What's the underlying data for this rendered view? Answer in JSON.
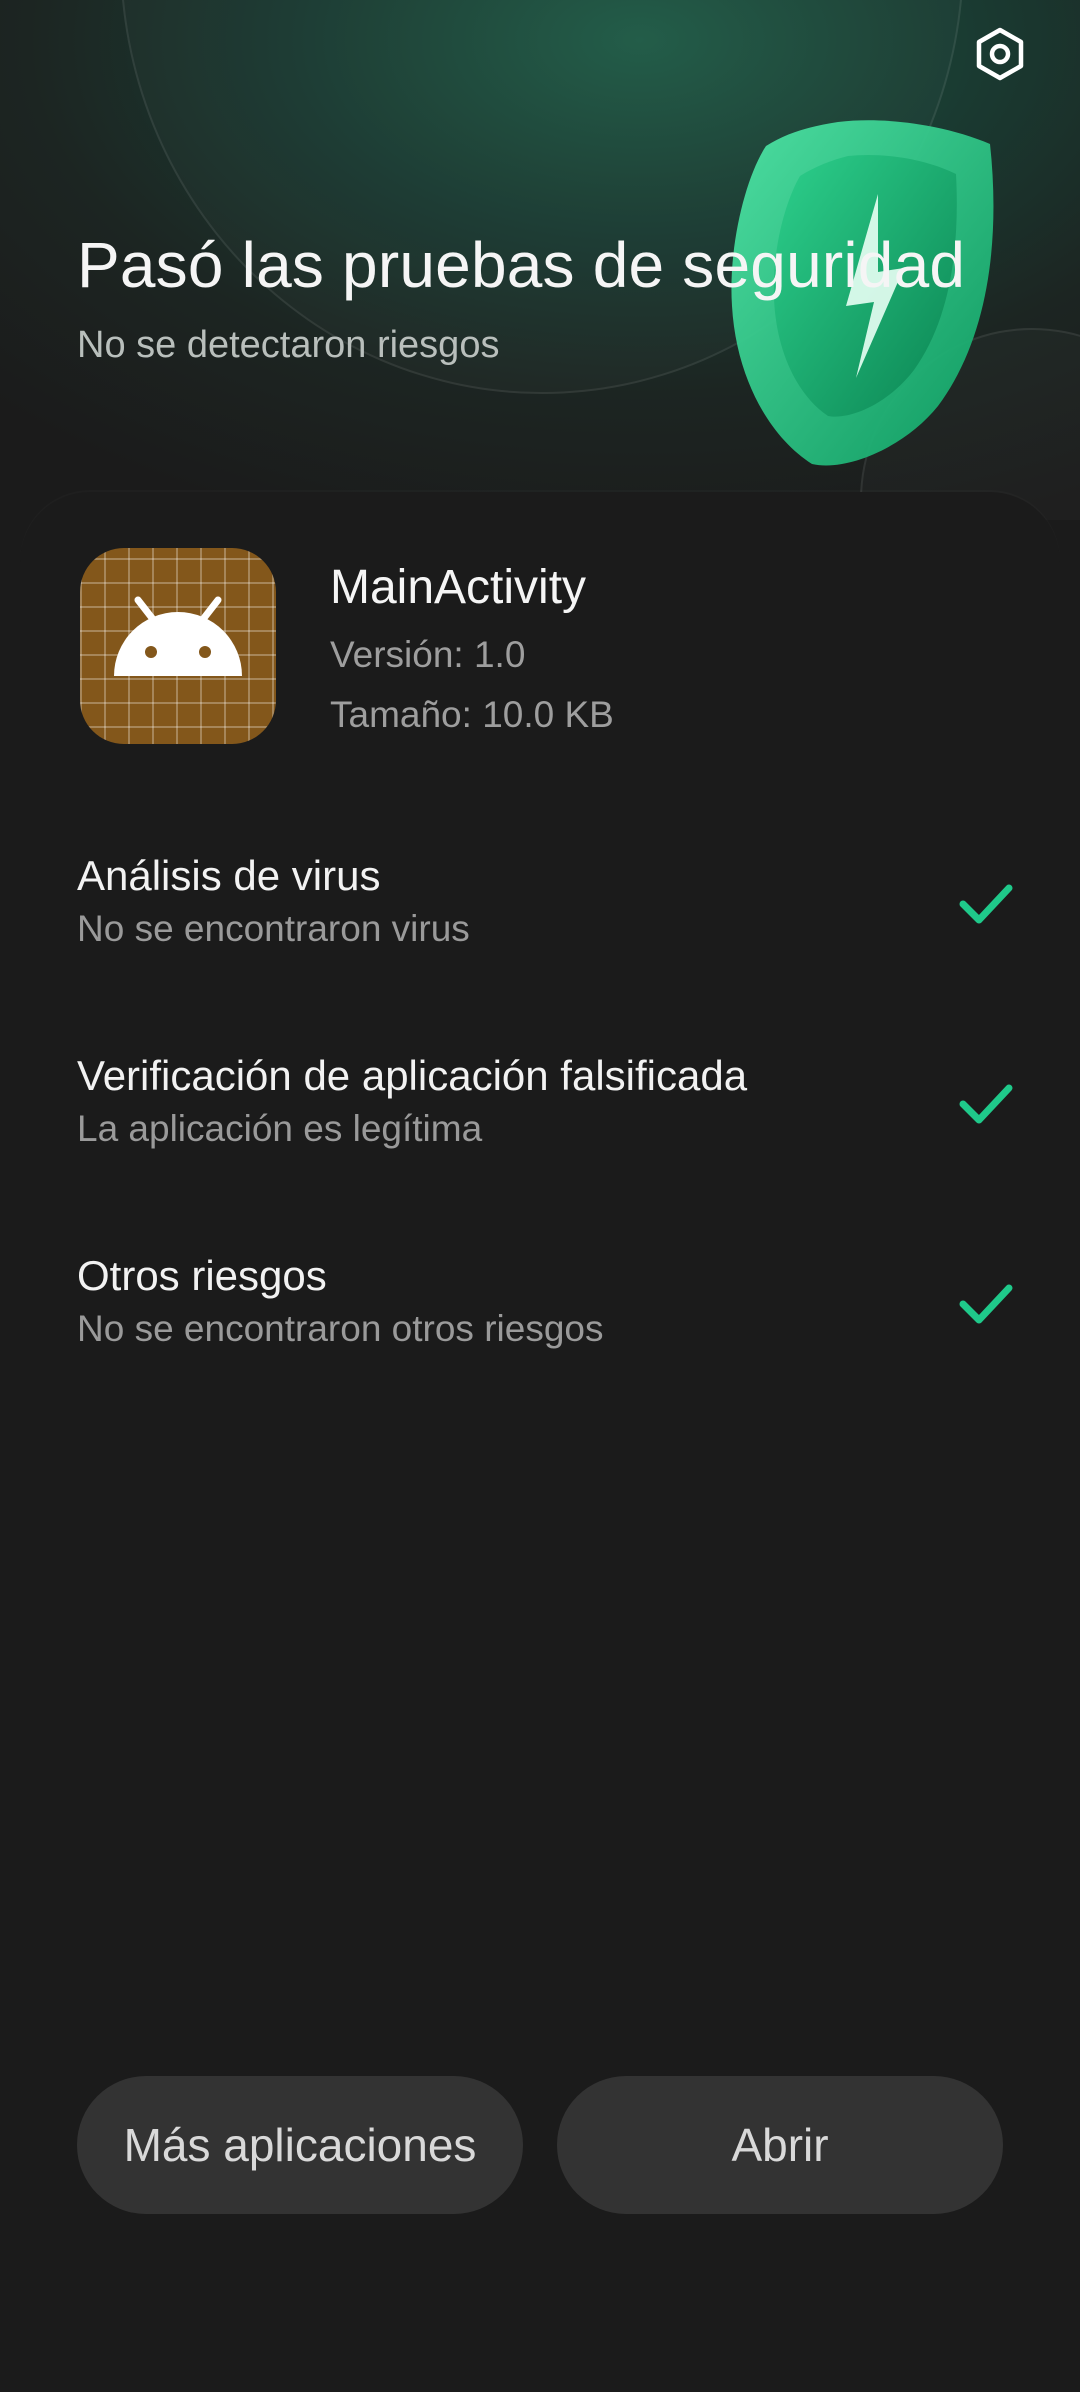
{
  "header": {
    "title": "Pasó las pruebas de seguridad",
    "subtitle": "No se detectaron riesgos",
    "settings_icon": "settings-hexagon-icon",
    "illustration": "shield-check-icon"
  },
  "app": {
    "name": "MainActivity",
    "version": "Versión: 1.0",
    "size": "Tamaño: 10.0 KB",
    "icon": "android-robot-icon"
  },
  "checks": [
    {
      "title": "Análisis de virus",
      "description": "No se encontraron virus",
      "status_icon": "checkmark-icon"
    },
    {
      "title": "Verificación de aplicación falsificada",
      "description": "La aplicación es legítima",
      "status_icon": "checkmark-icon"
    },
    {
      "title": "Otros riesgos",
      "description": "No se encontraron otros riesgos",
      "status_icon": "checkmark-icon"
    }
  ],
  "buttons": {
    "more_apps": "Más aplicaciones",
    "open": "Abrir"
  },
  "colors": {
    "accent": "#1fc98a",
    "background": "#1b1b1b",
    "button": "#333333",
    "app_icon": "#83571b"
  }
}
